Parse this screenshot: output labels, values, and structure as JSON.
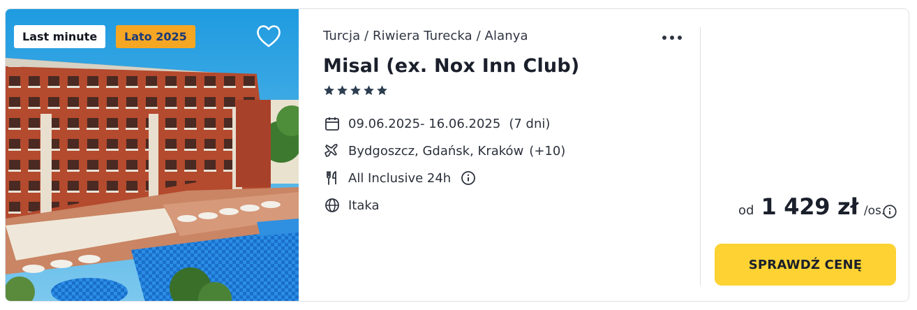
{
  "badges": {
    "last_minute": "Last minute",
    "season": "Lato 2025"
  },
  "hotel": {
    "breadcrumb": "Turcja / Riwiera Turecka / Alanya",
    "name": "Misal (ex. Nox Inn Club)",
    "stars": 5
  },
  "details": {
    "dates": "09.06.2025- 16.06.2025",
    "duration": "(7 dni)",
    "departures": "Bydgoszcz, Gdańsk, Kraków",
    "departures_more": "(+10)",
    "board": "All Inclusive 24h",
    "operator": "Itaka"
  },
  "price": {
    "from_label": "od",
    "amount": "1 429 zł",
    "per_label": "/os."
  },
  "cta": {
    "label": "SPRAWDŹ CENĘ"
  },
  "icons": {
    "favorite": "heart-icon",
    "more": "more-dots-icon",
    "star": "star-icon",
    "calendar": "calendar-icon",
    "plane": "plane-icon",
    "food": "cutlery-icon",
    "info": "info-icon",
    "globe": "globe-icon"
  },
  "colors": {
    "cta": "#fdd232",
    "season_badge": "#f5a623",
    "season_text": "#1b3a78",
    "stars": "#2c3e50"
  }
}
